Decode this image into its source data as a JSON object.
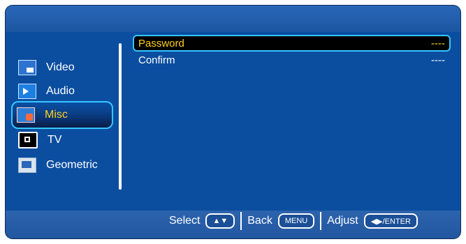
{
  "sidebar": {
    "items": [
      {
        "label": "Video",
        "icon": "video-icon"
      },
      {
        "label": "Audio",
        "icon": "audio-icon"
      },
      {
        "label": "Misc",
        "icon": "misc-icon",
        "selected": true
      },
      {
        "label": "TV",
        "icon": "tv-icon"
      },
      {
        "label": "Geometric",
        "icon": "geometric-icon"
      }
    ]
  },
  "main": {
    "rows": [
      {
        "label": "Password",
        "value": "----",
        "selected": true
      },
      {
        "label": "Confirm",
        "value": "----"
      }
    ]
  },
  "footer": {
    "select_label": "Select",
    "select_key": "▲▼",
    "back_label": "Back",
    "back_key": "MENU",
    "adjust_label": "Adjust",
    "adjust_key": "◀▶/ENTER"
  },
  "colors": {
    "panel_bg": "#0b4ea0",
    "highlight_text": "#ffd21a",
    "highlight_border": "#35c5ff"
  }
}
